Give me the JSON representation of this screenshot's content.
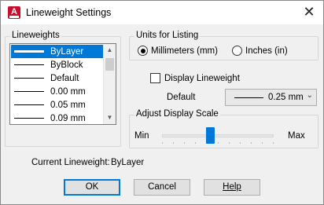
{
  "window": {
    "title": "Lineweight Settings",
    "icon": "autocad-app-icon",
    "icon_letter": "A",
    "close_glyph": "✕"
  },
  "lineweights": {
    "group_label": "Lineweights",
    "items": [
      {
        "label": "ByLayer",
        "selected": true,
        "thickness": "thick"
      },
      {
        "label": "ByBlock",
        "selected": false,
        "thickness": "thin"
      },
      {
        "label": "Default",
        "selected": false,
        "thickness": "thin"
      },
      {
        "label": "0.00 mm",
        "selected": false,
        "thickness": "thin"
      },
      {
        "label": "0.05 mm",
        "selected": false,
        "thickness": "thin"
      },
      {
        "label": "0.09 mm",
        "selected": false,
        "thickness": "thin"
      }
    ],
    "scroll_up": "▲",
    "scroll_down": "▼"
  },
  "units": {
    "group_label": "Units for Listing",
    "millimeters_label": "Millimeters (mm)",
    "inches_label": "Inches (in)",
    "selected": "millimeters"
  },
  "display": {
    "checkbox_label": "Display Lineweight",
    "checked": false,
    "default_label": "Default",
    "default_value": "0.25 mm",
    "chevron": "⌄"
  },
  "scale": {
    "group_label": "Adjust Display Scale",
    "min_label": "Min",
    "max_label": "Max",
    "level": 0.43
  },
  "current": {
    "label": "Current Lineweight:",
    "value": "ByLayer"
  },
  "buttons": {
    "ok": "OK",
    "cancel": "Cancel",
    "help": "Help"
  },
  "colors": {
    "accent": "#0078d7",
    "app_icon": "#c8102e"
  }
}
